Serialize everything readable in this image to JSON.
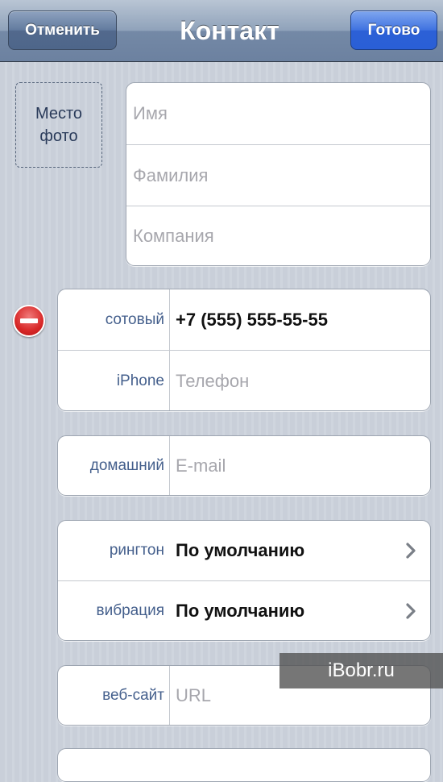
{
  "nav": {
    "cancel_label": "Отменить",
    "title": "Контакт",
    "done_label": "Готово"
  },
  "photo": {
    "label_line1": "Место",
    "label_line2": "фото"
  },
  "name_group": {
    "first_name_placeholder": "Имя",
    "last_name_placeholder": "Фамилия",
    "company_placeholder": "Компания"
  },
  "phone_group": {
    "rows": [
      {
        "label": "сотовый",
        "value": "+7 (555) 555-55-55"
      },
      {
        "label": "iPhone",
        "placeholder": "Телефон"
      }
    ]
  },
  "email_group": {
    "label": "домашний",
    "placeholder": "E-mail"
  },
  "sound_group": {
    "rows": [
      {
        "label": "рингтон",
        "value": "По умолчанию"
      },
      {
        "label": "вибрация",
        "value": "По умолчанию"
      }
    ]
  },
  "web_group": {
    "label": "веб-сайт",
    "placeholder": "URL"
  },
  "watermark": "iBobr.ru",
  "colors": {
    "nav_bar": "#8fa2ba",
    "done_button": "#2c60d6",
    "label_text": "#445f8c",
    "delete_badge": "#d82828"
  }
}
